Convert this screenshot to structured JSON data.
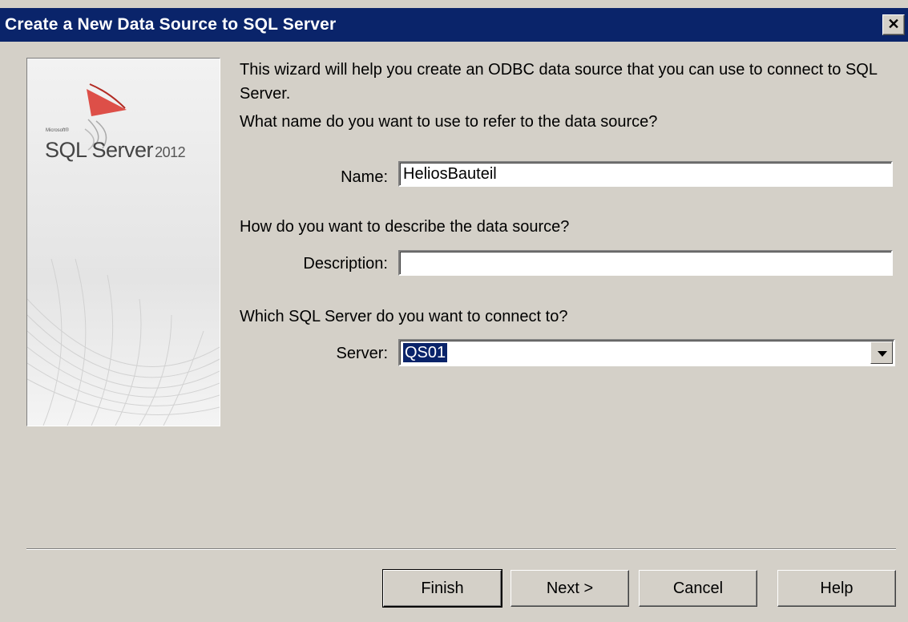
{
  "window": {
    "title": "Create a New Data Source to SQL Server",
    "close_glyph": "✕"
  },
  "branding": {
    "microsoft": "Microsoft®",
    "product": "SQL Server",
    "version": "2012"
  },
  "intro": {
    "line1": "This wizard will help you create an ODBC data source that you can use to connect to SQL Server.",
    "line2": "What name do you want to use to refer to the data source?"
  },
  "name_field": {
    "label": "Name:",
    "value": "HeliosBauteil"
  },
  "description_section": {
    "question": "How do you want to describe the data source?",
    "label": "Description:",
    "value": ""
  },
  "server_section": {
    "question": "Which SQL Server do you want to connect to?",
    "label": "Server:",
    "value": "QS01"
  },
  "buttons": {
    "finish": "Finish",
    "next": "Next >",
    "cancel": "Cancel",
    "help": "Help"
  },
  "icons": {
    "close": "close-icon",
    "dropdown": "chevron-down-icon",
    "logo": "sql-server-logo"
  },
  "colors": {
    "titlebar": "#0a246a",
    "dialog_bg": "#d4d0c8",
    "selection": "#0a246a",
    "logo_red": "#d9332a"
  }
}
